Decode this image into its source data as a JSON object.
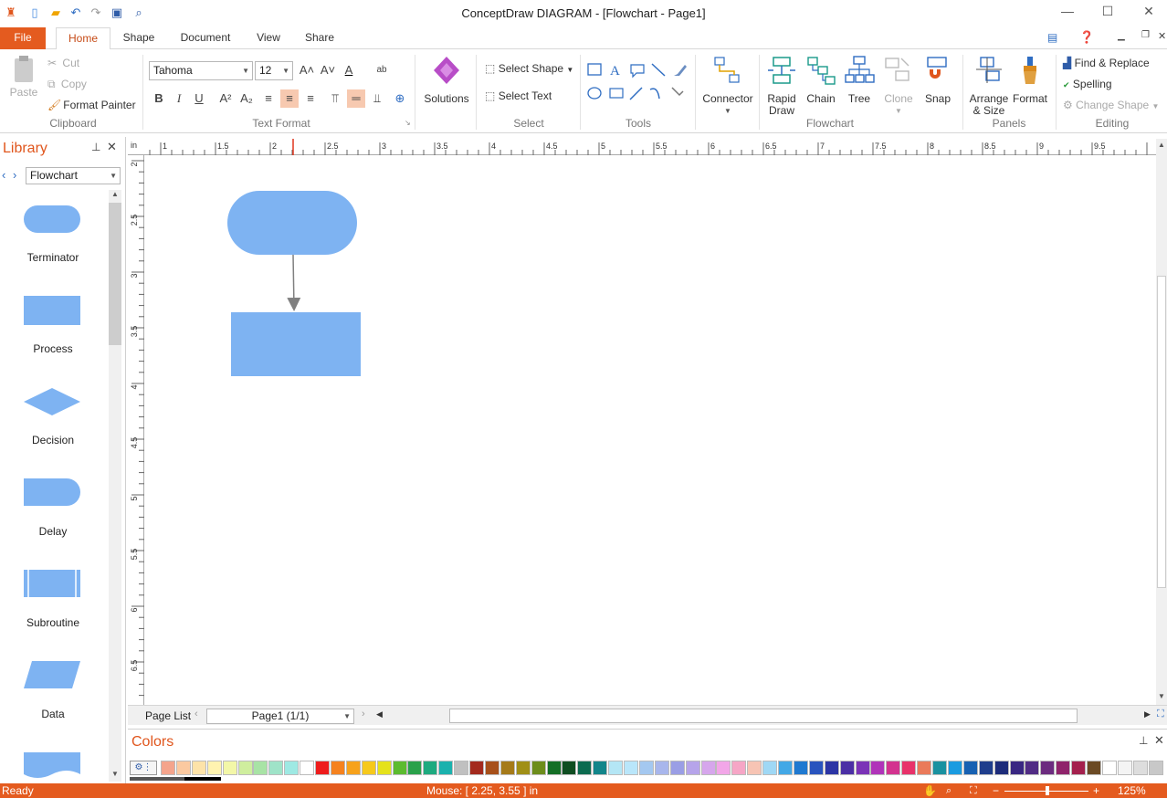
{
  "window": {
    "title": "ConceptDraw DIAGRAM - [Flowchart - Page1]"
  },
  "tabs": [
    {
      "label": "File"
    },
    {
      "label": "Home"
    },
    {
      "label": "Shape"
    },
    {
      "label": "Document"
    },
    {
      "label": "View"
    },
    {
      "label": "Share"
    }
  ],
  "ribbon": {
    "clipboard": {
      "paste": "Paste",
      "cut": "Cut",
      "copy": "Copy",
      "format_painter": "Format Painter",
      "group": "Clipboard"
    },
    "text_format": {
      "font": "Tahoma",
      "size": "12",
      "group": "Text Format"
    },
    "solutions": {
      "label": "Solutions"
    },
    "select": {
      "select_shape": "Select Shape",
      "select_text": "Select Text",
      "group": "Select"
    },
    "tools": {
      "group": "Tools"
    },
    "connector": {
      "label": "Connector"
    },
    "flowchart": {
      "rapid_draw_1": "Rapid",
      "rapid_draw_2": "Draw",
      "chain": "Chain",
      "tree": "Tree",
      "clone": "Clone",
      "snap": "Snap",
      "group": "Flowchart"
    },
    "panels": {
      "arrange_1": "Arrange",
      "arrange_2": "& Size",
      "format": "Format",
      "group": "Panels"
    },
    "editing": {
      "find_replace": "Find & Replace",
      "spelling": "Spelling",
      "change_shape": "Change Shape",
      "group": "Editing"
    }
  },
  "library": {
    "title": "Library",
    "selected": "Flowchart",
    "items": [
      {
        "label": "Terminator"
      },
      {
        "label": "Process"
      },
      {
        "label": "Decision"
      },
      {
        "label": "Delay"
      },
      {
        "label": "Subroutine"
      },
      {
        "label": "Data"
      }
    ]
  },
  "ruler": {
    "unit": "in",
    "h_ticks": [
      "1",
      "1.5",
      "2",
      "2.5",
      "3",
      "3.5",
      "4",
      "4.5",
      "5",
      "5.5",
      "6",
      "6.5",
      "7",
      "7.5",
      "8",
      "8.5",
      "9",
      "9.5"
    ],
    "v_ticks": [
      "2",
      "2.5",
      "3",
      "3.5",
      "4",
      "4.5",
      "5",
      "5.5",
      "6",
      "6.5"
    ]
  },
  "pagebar": {
    "page_list": "Page List",
    "page": "Page1 (1/1)"
  },
  "colors_panel": {
    "title": "Colors",
    "swatches": [
      "#f4a48c",
      "#fbc9a0",
      "#fde3a9",
      "#fff3b0",
      "#f3f7a8",
      "#cfee9e",
      "#a8e3a5",
      "#9fe3c8",
      "#9ee9e3",
      "#ffffff",
      "#ee1c1c",
      "#f5821f",
      "#f7a21b",
      "#f6c91c",
      "#e5e21c",
      "#5cbb2f",
      "#2aa14a",
      "#1eaa7f",
      "#1bb1ad",
      "#c0c0c0",
      "#a32a1d",
      "#a7501a",
      "#a57a19",
      "#a08f16",
      "#6d8d1c",
      "#146f26",
      "#0f4d21",
      "#0c6b50",
      "#12858a",
      "#b4e6f5",
      "#b9e6fa",
      "#a4c8f0",
      "#a8b6ec",
      "#9a9ee5",
      "#b6a4ea",
      "#d6a6ec",
      "#f2a6e8",
      "#f6a6c6",
      "#f7c4b4",
      "#9fd8f5",
      "#43a8e6",
      "#1f79d0",
      "#2954be",
      "#2c35a5",
      "#4b2fa5",
      "#7b33b7",
      "#b034b9",
      "#d3338f",
      "#e8326a",
      "#ea7a5a",
      "#1a91a0",
      "#1a9be0",
      "#1861b2",
      "#1f3e8c",
      "#1d2c7a",
      "#392782",
      "#512c85",
      "#6c2c7f",
      "#8f236b",
      "#a4204d",
      "#6b4a24",
      "#ffffff",
      "#f4f4f4",
      "#dddddd",
      "#c8c8c8"
    ]
  },
  "status": {
    "ready": "Ready",
    "mouse": "Mouse: [ 2.25, 3.55 ] in",
    "zoom": "125%"
  },
  "colors": {
    "accent": "#e45b1f",
    "shape_fill": "#7eb3f2",
    "connector": "#808080"
  }
}
